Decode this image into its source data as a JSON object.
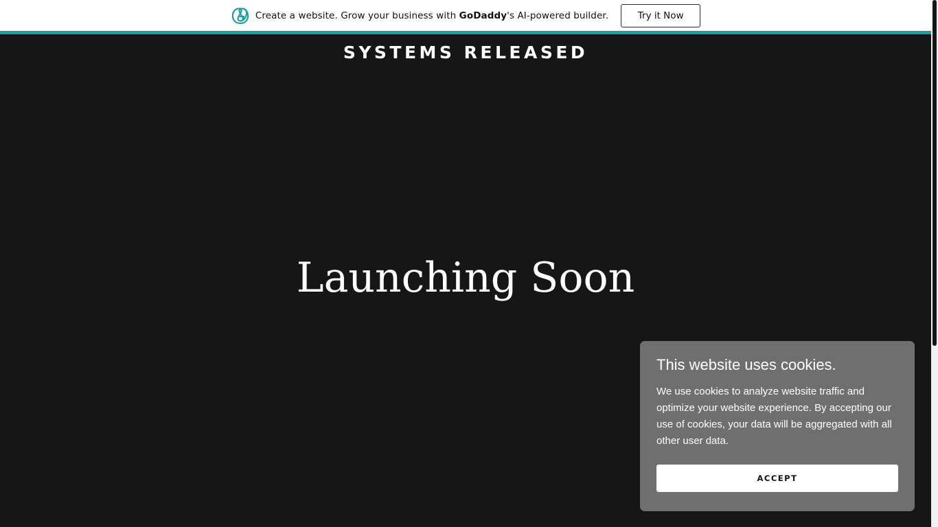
{
  "promo": {
    "logo_icon": "godaddy-logo-icon",
    "text_before": "Create a website. Grow your business with ",
    "brand": "GoDaddy",
    "text_after": "'s AI-powered builder.",
    "button_label": "Try it Now",
    "accent_color": "#1ba0a6"
  },
  "site": {
    "title": "SYSTEMS RELEASED"
  },
  "hero": {
    "heading": "Launching Soon"
  },
  "cookie": {
    "title": "This website uses cookies.",
    "body": "We use cookies to analyze website traffic and optimize your website experience. By accepting our use of cookies, your data will be aggregated with all other user data.",
    "accept_label": "ACCEPT"
  },
  "colors": {
    "background": "#161616",
    "cookie_panel": "#6f6f6f",
    "brand_teal": "#1ba0a6"
  }
}
